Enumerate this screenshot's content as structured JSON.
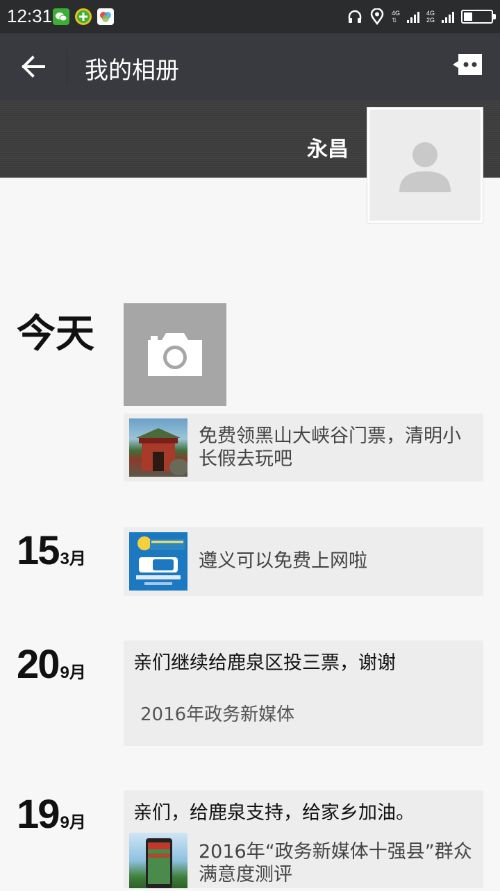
{
  "status_bar": {
    "time": "12:31",
    "net_top": "4G",
    "net_bottom": "2G"
  },
  "header": {
    "title": "我的相册"
  },
  "profile": {
    "name": "永昌"
  },
  "timeline": {
    "today_label": "今天",
    "today_share": "免费领黑山大峡谷门票，清明小长假去玩吧",
    "entry1": {
      "day": "15",
      "month": "3月",
      "share": "遵义可以免费上网啦"
    },
    "entry2": {
      "day": "20",
      "month": "9月",
      "caption": "亲们继续给鹿泉区投三票，谢谢",
      "sub": "2016年政务新媒体"
    },
    "entry3": {
      "day": "19",
      "month": "9月",
      "caption": "亲们，给鹿泉支持，给家乡加油。",
      "share": "2016年“政务新媒体十强县”群众满意度测评"
    }
  },
  "colors": {
    "titlebar": "#393a3f",
    "statusbar": "#2b2c2e",
    "card": "#ededed",
    "background": "#f7f7f7"
  }
}
